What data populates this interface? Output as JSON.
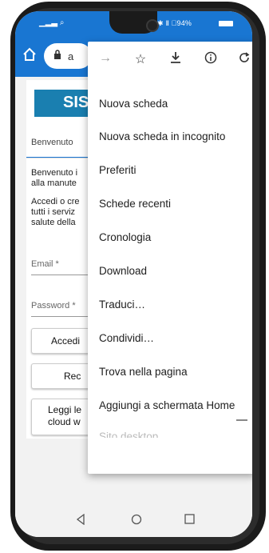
{
  "status": {
    "left": "▁▂▃ ⌕",
    "right": "✱ Ⅱ ⃞94%"
  },
  "omnibox": {
    "lock": "🔒",
    "url": "a"
  },
  "page": {
    "logo_text": "SIS",
    "tab_label": "Benvenuto",
    "para1": "Benvenuto i\nalla manute",
    "para2": "Accedi o cre\ntutti i serviz\nsalute della",
    "email_label": "Email *",
    "password_label": "Password *",
    "login_button": "Accedi",
    "recover_button": "Rec",
    "read_button": "Leggi le\ncloud w"
  },
  "menu": {
    "top_icons": [
      "forward-icon",
      "star-icon",
      "download-icon",
      "info-icon",
      "refresh-icon"
    ],
    "items": [
      "Nuova scheda",
      "Nuova scheda in incognito",
      "Preferiti",
      "Schede recenti",
      "Cronologia",
      "Download",
      "Traduci…",
      "Condividi…",
      "Trova nella pagina",
      "Aggiungi a schermata Home",
      "Sito desktop"
    ]
  },
  "navbar": [
    "back-icon",
    "home-icon",
    "recents-icon"
  ],
  "colors": {
    "brand": "#1976d2",
    "logo": "#1a7fb0"
  }
}
